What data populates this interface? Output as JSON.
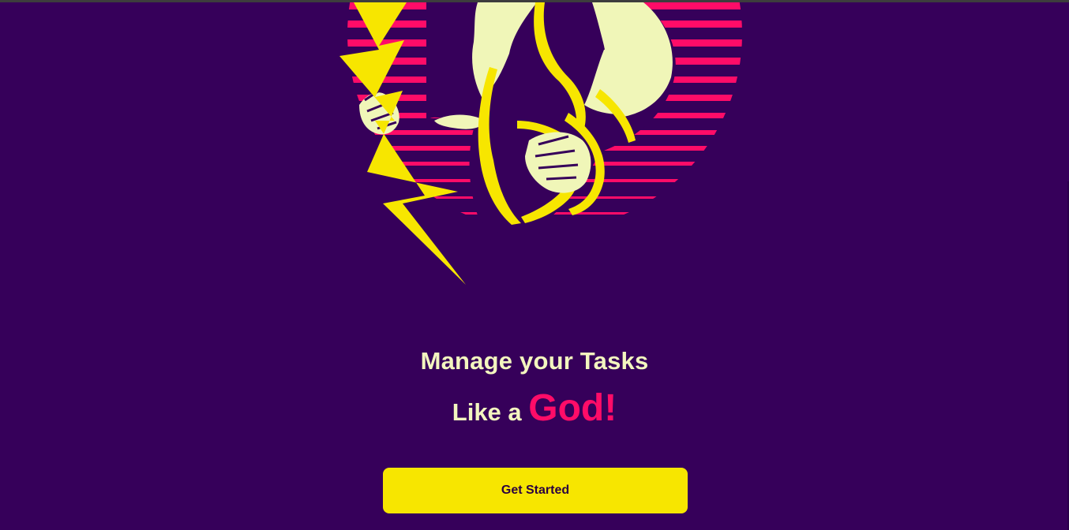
{
  "hero": {
    "headline": "Manage your Tasks",
    "subline_lead": "Like a ",
    "subline_accent": "God!"
  },
  "cta": {
    "label": "Get Started"
  },
  "colors": {
    "background": "#36005a",
    "headline_text": "#f3f6bf",
    "accent_pink": "#ff0c68",
    "button_yellow": "#f7e600",
    "button_text": "#2a0040"
  },
  "illustration": {
    "icon": "zeus-lightning-illustration"
  }
}
